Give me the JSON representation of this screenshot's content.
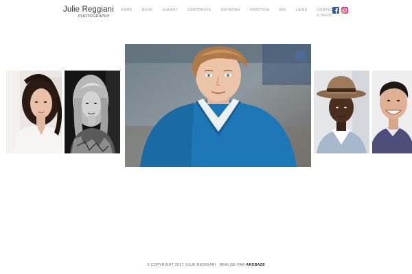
{
  "brand": {
    "name": "Julie Reggiani",
    "subtitle": "PHOTOGRAPHY"
  },
  "nav": {
    "items": [
      {
        "label": "HOME"
      },
      {
        "label": "BOOK"
      },
      {
        "label": "ENFANT"
      },
      {
        "label": "CORPORATE"
      },
      {
        "label": "ARTWORK"
      },
      {
        "label": "PAROTION"
      },
      {
        "label": "BIO"
      },
      {
        "label": "LIENS"
      },
      {
        "label": "CONTACT & INFOS"
      }
    ]
  },
  "social": {
    "facebook": {
      "icon": "facebook-icon",
      "color": "#3b5998"
    },
    "instagram": {
      "icon": "instagram-icon",
      "color": "#c13584"
    }
  },
  "gallery": {
    "photos": [
      {
        "subject": "woman-dark-hair-color",
        "style": "color"
      },
      {
        "subject": "woman-blonde-bw",
        "style": "black-and-white"
      },
      {
        "subject": "man-blue-sweater-featured",
        "style": "color"
      },
      {
        "subject": "man-hat",
        "style": "color"
      },
      {
        "subject": "man-smiling",
        "style": "color"
      }
    ]
  },
  "footer": {
    "copyright": "© COPYRIGHT 2017 JULIE REGGIANI . RÉALISÉ PAR ",
    "maker": "AROBAZE"
  }
}
